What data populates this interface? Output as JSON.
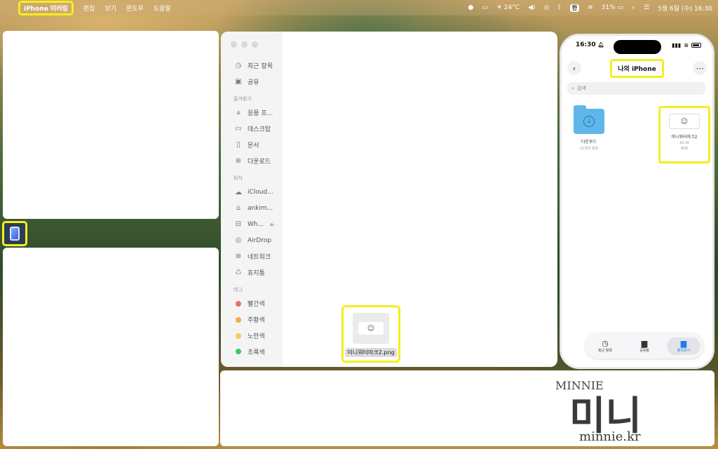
{
  "menubar": {
    "app_name": "iPhone 미러링",
    "menus": [
      "편집",
      "보기",
      "윈도우",
      "도움말"
    ],
    "weather": "24°C",
    "battery": "31%",
    "input_method": "한",
    "datetime": "5월 6일 (수) 16:30"
  },
  "finder": {
    "sections": {
      "favorites": "즐겨찾기",
      "locations": "위치",
      "tags": "태그"
    },
    "top_items": [
      {
        "label": "최근 항목",
        "icon": "clock-icon"
      },
      {
        "label": "공유",
        "icon": "share-folder-icon"
      }
    ],
    "favorites": [
      {
        "label": "응용 프...",
        "icon": "applications-icon"
      },
      {
        "label": "데스크탑",
        "icon": "desktop-icon"
      },
      {
        "label": "문서",
        "icon": "document-icon"
      },
      {
        "label": "다운로드",
        "icon": "download-icon"
      }
    ],
    "locations": [
      {
        "label": "iCloud...",
        "icon": "cloud-icon"
      },
      {
        "label": "ankim...",
        "icon": "home-icon"
      },
      {
        "label": "Wh...",
        "icon": "drive-icon"
      },
      {
        "label": "AirDrop",
        "icon": "airdrop-icon"
      },
      {
        "label": "네트워크",
        "icon": "network-icon"
      },
      {
        "label": "휴지통",
        "icon": "trash-icon"
      }
    ],
    "tags": [
      {
        "label": "빨간색",
        "color": "#f16a6a"
      },
      {
        "label": "주황색",
        "color": "#f5a94a"
      },
      {
        "label": "노란색",
        "color": "#f2d04a"
      },
      {
        "label": "초록색",
        "color": "#3fc46a"
      }
    ],
    "file": {
      "name": "미니워터마크2.png"
    }
  },
  "iphone": {
    "time": "16:30",
    "title": "나의 iPhone",
    "search_placeholder": "검색",
    "folder": {
      "name": "다운로드",
      "sub": "12개의 항목"
    },
    "file": {
      "name": "미니워터마크2",
      "time": "16:30",
      "size": "8KB"
    },
    "tabs": [
      {
        "label": "최근 항목",
        "icon": "clock-icon"
      },
      {
        "label": "공유됨",
        "icon": "shared-folder-icon"
      },
      {
        "label": "둘러보기",
        "icon": "folder-icon"
      }
    ]
  },
  "watermark": {
    "line1": "MINNIE",
    "line2": "미니",
    "line3": "minnie.kr"
  }
}
